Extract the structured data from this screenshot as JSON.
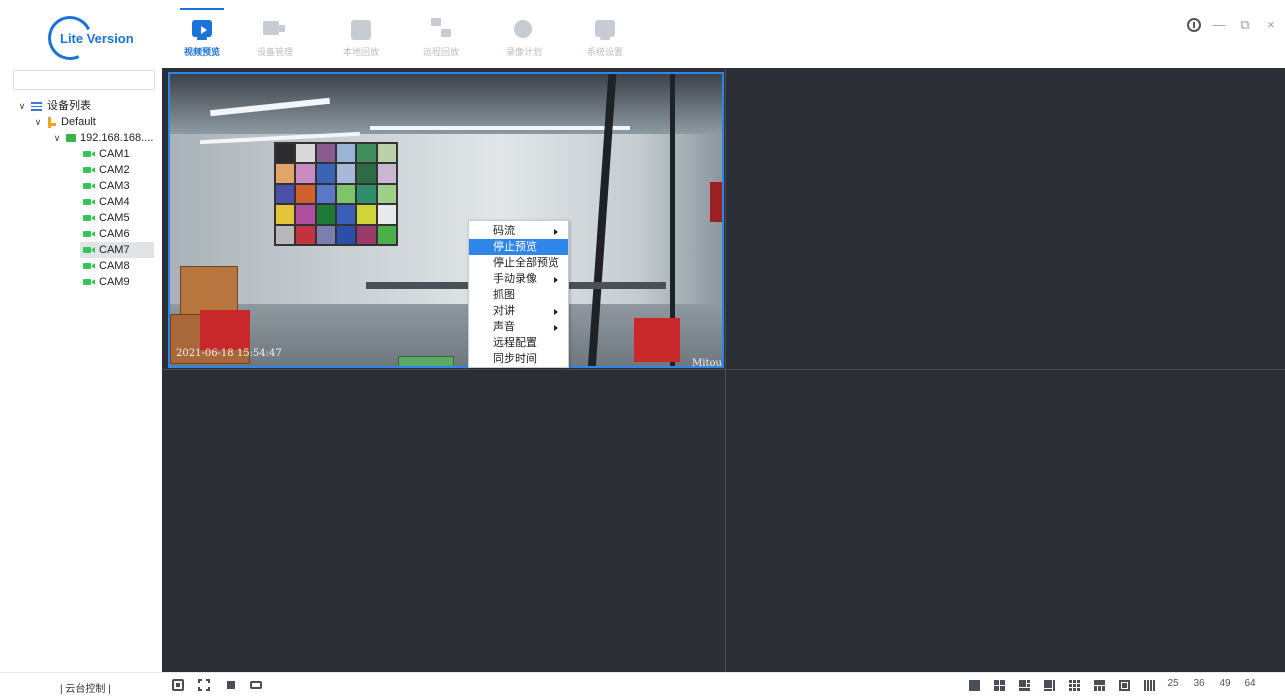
{
  "header": {
    "logo_text": "Lite Version",
    "tabs": [
      {
        "label": "视频预览",
        "icon": "video-preview-icon",
        "active": true
      },
      {
        "label": "设备管理",
        "icon": "device-management-icon",
        "active": false
      },
      {
        "label": "本地回放",
        "icon": "local-playback-icon",
        "active": false
      },
      {
        "label": "远程回放",
        "icon": "remote-playback-icon",
        "active": false
      },
      {
        "label": "录像计划",
        "icon": "recording-schedule-icon",
        "active": false
      },
      {
        "label": "系统设置",
        "icon": "system-settings-icon",
        "active": false
      }
    ],
    "window_controls": {
      "minimize": "—",
      "restore": "⧉",
      "close": "×"
    }
  },
  "sidebar": {
    "search_value": "",
    "tree": {
      "root_label": "设备列表",
      "group_label": "Default",
      "device_label": "192.168.168....",
      "cameras": [
        "CAM1",
        "CAM2",
        "CAM3",
        "CAM4",
        "CAM5",
        "CAM6",
        "CAM7",
        "CAM8",
        "CAM9"
      ],
      "selected_camera": "CAM7"
    }
  },
  "video": {
    "layout": "2x2",
    "active_pane": 1,
    "osd_timestamp": "2021-06-18 15:54:47",
    "osd_brand": "Mitou",
    "context_menu": [
      {
        "label": "码流",
        "submenu": true,
        "highlighted": false
      },
      {
        "label": "停止预览",
        "submenu": false,
        "highlighted": true
      },
      {
        "label": "停止全部预览",
        "submenu": false,
        "highlighted": false
      },
      {
        "label": "手动录像",
        "submenu": true,
        "highlighted": false
      },
      {
        "label": "抓图",
        "submenu": false,
        "highlighted": false
      },
      {
        "label": "对讲",
        "submenu": true,
        "highlighted": false
      },
      {
        "label": "声音",
        "submenu": true,
        "highlighted": false
      },
      {
        "label": "远程配置",
        "submenu": false,
        "highlighted": false
      },
      {
        "label": "同步时间",
        "submenu": false,
        "highlighted": false
      }
    ]
  },
  "bottom_bar": {
    "ptz_label": "| 云台控制 |",
    "tools": [
      "snapshot-icon",
      "fullscreen-icon",
      "stop-all-icon",
      "cycle-icon"
    ],
    "layout_numbers": [
      "25",
      "36",
      "49",
      "64"
    ]
  },
  "colors": {
    "accent": "#1a73d6",
    "active_border": "#2f86e8",
    "video_bg": "#2b2e35",
    "camera_icon": "#37c559"
  }
}
